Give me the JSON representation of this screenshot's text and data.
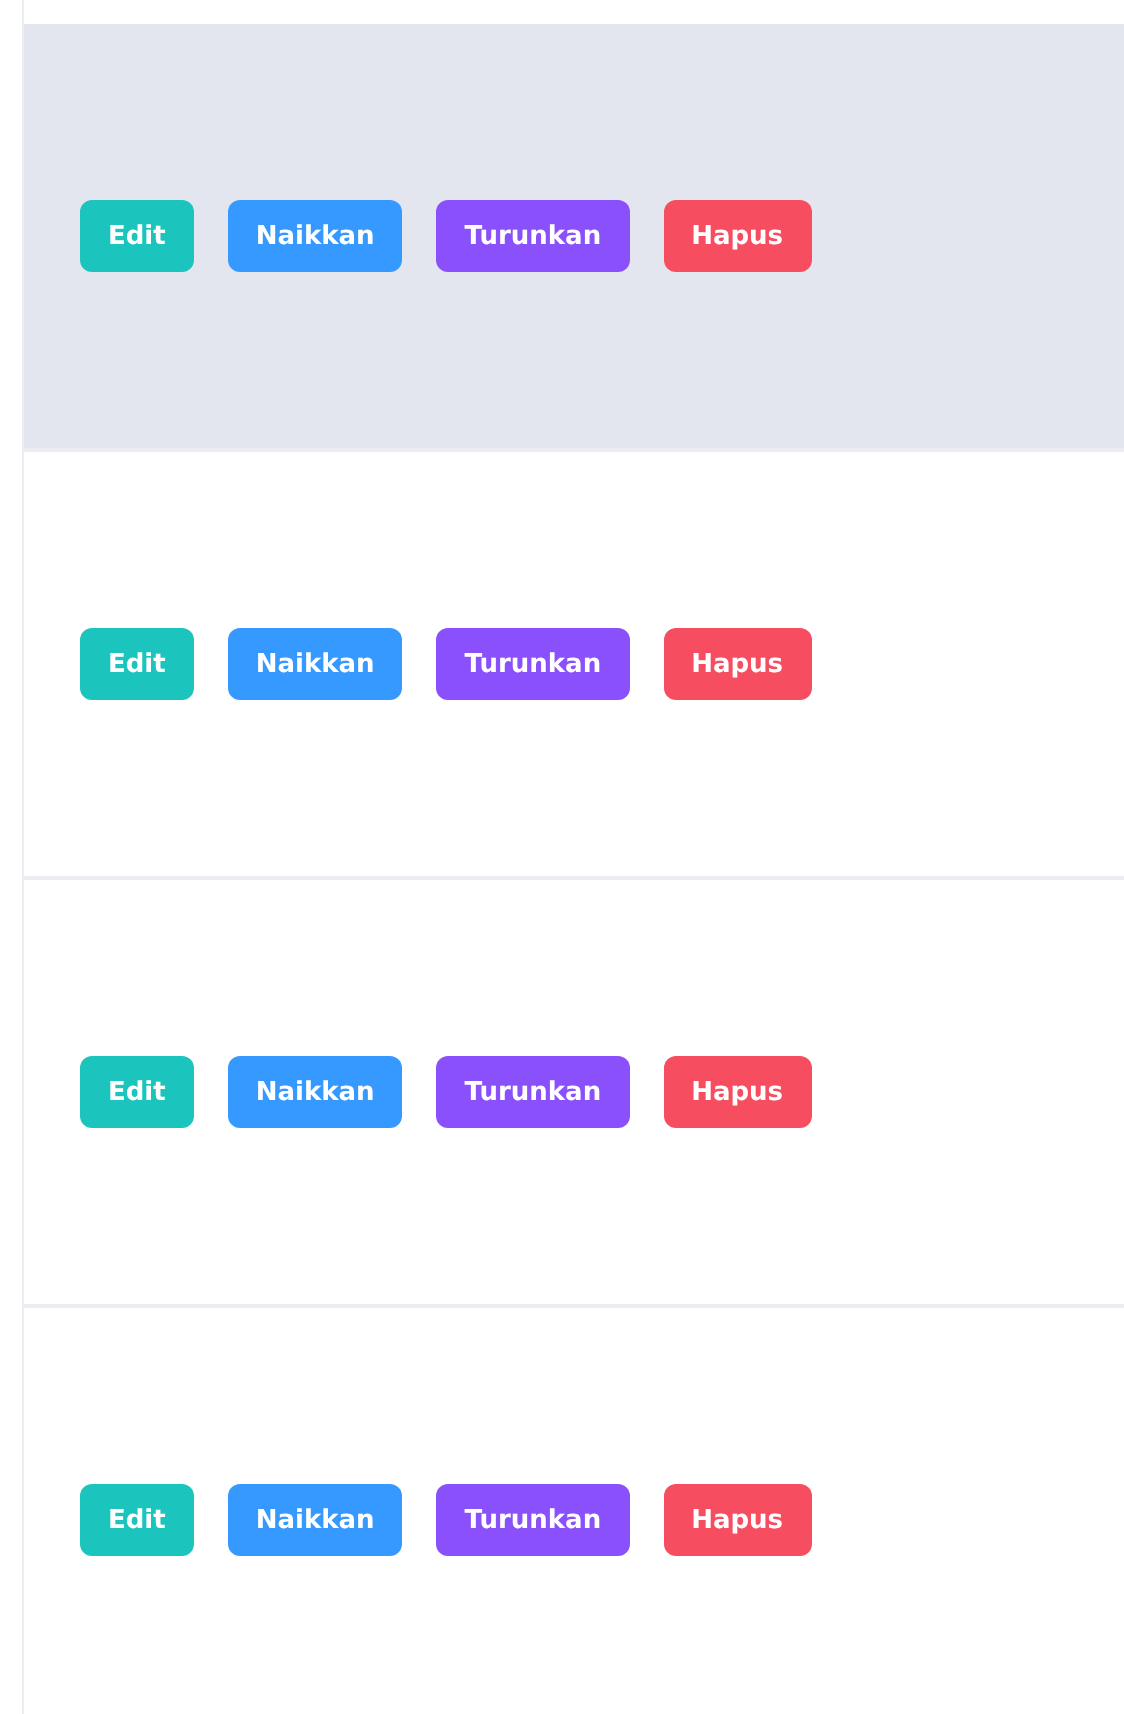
{
  "rows": [
    {
      "highlighted": true,
      "buttons": [
        {
          "label": "Edit",
          "kind": "edit"
        },
        {
          "label": "Naikkan",
          "kind": "up"
        },
        {
          "label": "Turunkan",
          "kind": "down"
        },
        {
          "label": "Hapus",
          "kind": "delete"
        }
      ]
    },
    {
      "highlighted": false,
      "buttons": [
        {
          "label": "Edit",
          "kind": "edit"
        },
        {
          "label": "Naikkan",
          "kind": "up"
        },
        {
          "label": "Turunkan",
          "kind": "down"
        },
        {
          "label": "Hapus",
          "kind": "delete"
        }
      ]
    },
    {
      "highlighted": false,
      "buttons": [
        {
          "label": "Edit",
          "kind": "edit"
        },
        {
          "label": "Naikkan",
          "kind": "up"
        },
        {
          "label": "Turunkan",
          "kind": "down"
        },
        {
          "label": "Hapus",
          "kind": "delete"
        }
      ]
    },
    {
      "highlighted": false,
      "buttons": [
        {
          "label": "Edit",
          "kind": "edit"
        },
        {
          "label": "Naikkan",
          "kind": "up"
        },
        {
          "label": "Turunkan",
          "kind": "down"
        },
        {
          "label": "Hapus",
          "kind": "delete"
        }
      ]
    }
  ]
}
